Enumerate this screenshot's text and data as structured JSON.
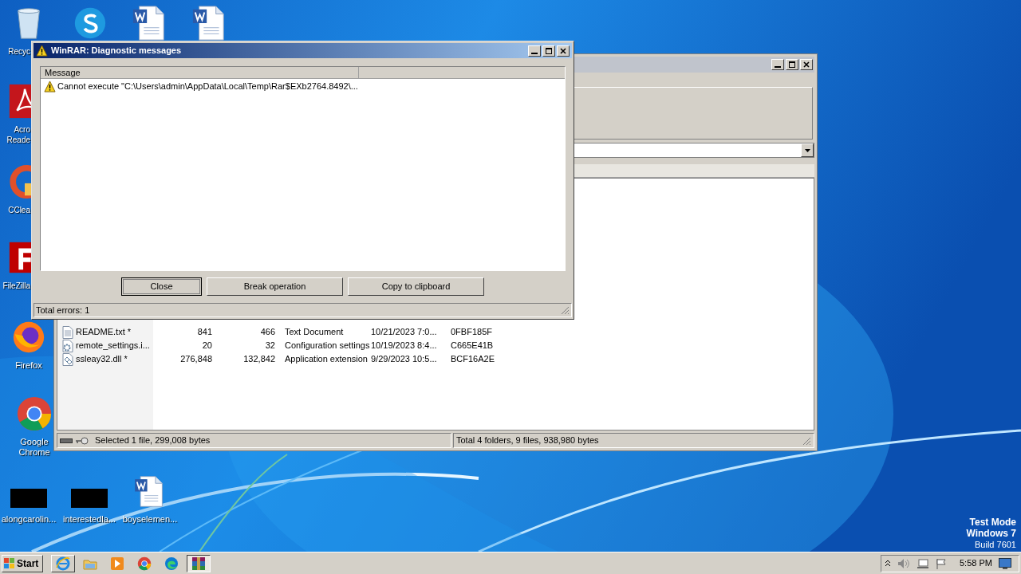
{
  "desktop": {
    "left_icons": [
      {
        "kind": "recycle",
        "label": "Recyc"
      },
      {
        "kind": "acrobat",
        "label": "Acro\nReade"
      },
      {
        "kind": "ccleaner",
        "label": "CClea"
      },
      {
        "kind": "filezilla",
        "label": "FileZilla"
      },
      {
        "kind": "firefox",
        "label": "Firefox"
      },
      {
        "kind": "chrome",
        "label": "Google\nChrome"
      }
    ],
    "top_icons": [
      {
        "kind": "skype"
      },
      {
        "kind": "word"
      },
      {
        "kind": "word"
      }
    ],
    "bottom_icons": [
      {
        "kind": "black",
        "label": "alongcarolin..."
      },
      {
        "kind": "black",
        "label": "interestedla..."
      },
      {
        "kind": "word",
        "label": "boyselemen..."
      }
    ],
    "os_info": [
      "Test Mode",
      "Windows 7",
      "Build 7601"
    ]
  },
  "archive_window": {
    "rows": [
      {
        "name": "README.txt *",
        "size": "841",
        "packed": "466",
        "type": "Text Document",
        "modified": "10/21/2023 7:0...",
        "crc": "0FBF185F",
        "kind": "text"
      },
      {
        "name": "remote_settings.i...",
        "size": "20",
        "packed": "32",
        "type": "Configuration settings",
        "modified": "10/19/2023 8:4...",
        "crc": "C665E41B",
        "kind": "config"
      },
      {
        "name": "ssleay32.dll *",
        "size": "276,848",
        "packed": "132,842",
        "type": "Application extension",
        "modified": "9/29/2023 10:5...",
        "crc": "BCF16A2E",
        "kind": "dll"
      }
    ],
    "status_left": "Selected 1 file, 299,008 bytes",
    "status_right": "Total 4 folders, 9 files, 938,980 bytes"
  },
  "dialog": {
    "title": "WinRAR: Diagnostic messages",
    "column": "Message",
    "messages": [
      "Cannot execute \"C:\\Users\\admin\\AppData\\Local\\Temp\\Rar$EXb2764.8492\\..."
    ],
    "buttons": [
      {
        "label": "Close",
        "default": true
      },
      {
        "label": "Break operation",
        "default": false
      },
      {
        "label": "Copy to clipboard",
        "default": false
      }
    ],
    "status": "Total errors: 1"
  },
  "taskbar": {
    "start": "Start",
    "apps": [
      {
        "kind": "ie",
        "active": false
      },
      {
        "kind": "explorer",
        "active": false
      },
      {
        "kind": "media",
        "active": false
      },
      {
        "kind": "chrome",
        "active": false
      },
      {
        "kind": "edge",
        "active": false
      },
      {
        "kind": "winrar",
        "active": true
      }
    ],
    "time": "5:58 PM"
  }
}
